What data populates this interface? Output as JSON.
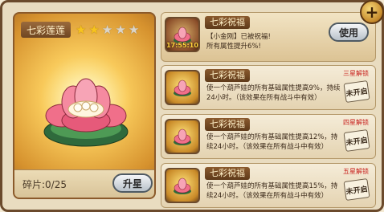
{
  "close_label": "+",
  "left": {
    "name": "七彩莲莲",
    "stars": {
      "filled": 2,
      "total": 5
    },
    "fragments": "碎片:0/25",
    "upgrade_button": "升星"
  },
  "active_card": {
    "title": "七彩祝福",
    "timer": "17:55:10",
    "line1": "【小金刚】已被祝福!",
    "line2": "所有属性提升6%!",
    "use_button": "使用"
  },
  "locked_cards": [
    {
      "title": "七彩祝福",
      "unlock": "三星解锁",
      "desc": "使一个葫芦娃的所有基础属性提高9%，持续24小时。（该效果在所有战斗中有效）",
      "status": "未开启"
    },
    {
      "title": "七彩祝福",
      "unlock": "四星解锁",
      "desc": "使一个葫芦娃的所有基础属性提高12%，持续24小时。（该效果在所有战斗中有效）",
      "status": "未开启"
    },
    {
      "title": "七彩祝福",
      "unlock": "五星解锁",
      "desc": "使一个葫芦娃的所有基础属性提高15%，持续24小时。（该效果在所有战斗中有效）",
      "status": "未开启"
    }
  ],
  "colors": {
    "frame": "#6b4a2c",
    "accent_gold": "#f7c41d",
    "unlock_red": "#c8221e"
  }
}
